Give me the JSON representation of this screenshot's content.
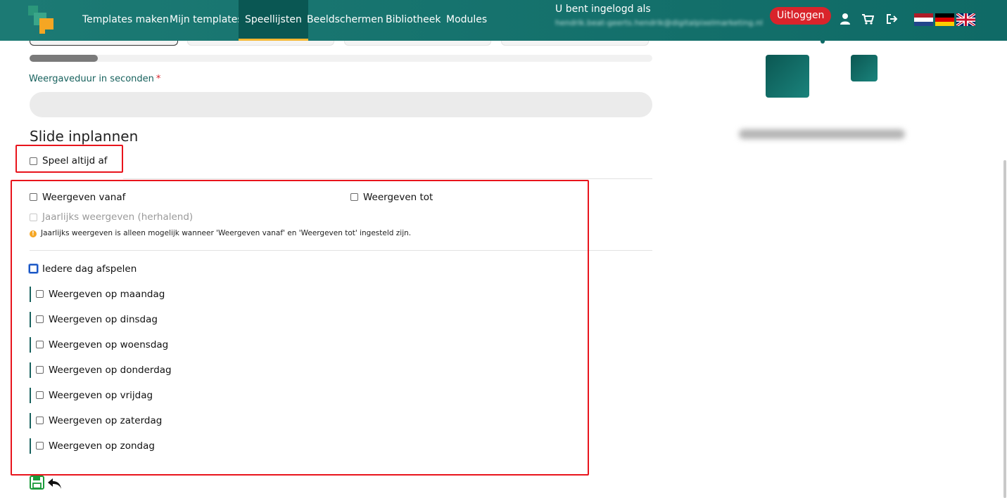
{
  "nav": {
    "items": [
      {
        "label": "Templates maken",
        "active": false
      },
      {
        "label": "Mijn templates",
        "active": false
      },
      {
        "label": "Speellijsten",
        "active": true
      },
      {
        "label": "Beeldschermen",
        "active": false
      },
      {
        "label": "Bibliotheek",
        "active": false
      },
      {
        "label": "Modules",
        "active": false
      }
    ],
    "login_label": "U bent ingelogd als",
    "login_email": "hendrik.beat-geerts.hendrik@digitalpixelmarketing.nl",
    "logout_label": "Uitloggen",
    "icons": [
      "user-icon",
      "cart-icon",
      "sign-out-icon"
    ],
    "flags": [
      "flag-nl-icon",
      "flag-de-icon",
      "flag-uk-icon"
    ]
  },
  "form": {
    "duration_label": "Weergaveduur in seconden",
    "duration_required": "*",
    "duration_value": "",
    "section_title": "Slide inplannen",
    "always_play": {
      "label": "Speel altijd af",
      "checked": false
    },
    "show_from": {
      "label": "Weergeven vanaf",
      "checked": false
    },
    "show_until": {
      "label": "Weergeven tot",
      "checked": false
    },
    "yearly": {
      "label": "Jaarlijks weergeven (herhalend)",
      "checked": false,
      "disabled": true
    },
    "info_text": "Jaarlijks weergeven is alleen mogelijk wanneer 'Weergeven vanaf' en 'Weergeven tot' ingesteld zijn.",
    "every_day": {
      "label": "Iedere dag afspelen",
      "checked": false
    },
    "days": [
      {
        "label": "Weergeven op maandag",
        "checked": false
      },
      {
        "label": "Weergeven op dinsdag",
        "checked": false
      },
      {
        "label": "Weergeven op woensdag",
        "checked": false
      },
      {
        "label": "Weergeven op donderdag",
        "checked": false
      },
      {
        "label": "Weergeven op vrijdag",
        "checked": false
      },
      {
        "label": "Weergeven op zaterdag",
        "checked": false
      },
      {
        "label": "Weergeven op zondag",
        "checked": false
      }
    ]
  },
  "actions": {
    "save_icon": "save-icon",
    "back_icon": "back-arrow-icon"
  },
  "colors": {
    "header": "#0f6a66",
    "active_tab_underline": "#f5b733",
    "logout": "#d9242b",
    "highlight_box": "#e8141c",
    "label_teal": "#17615d",
    "save_green": "#1a9b3a"
  }
}
